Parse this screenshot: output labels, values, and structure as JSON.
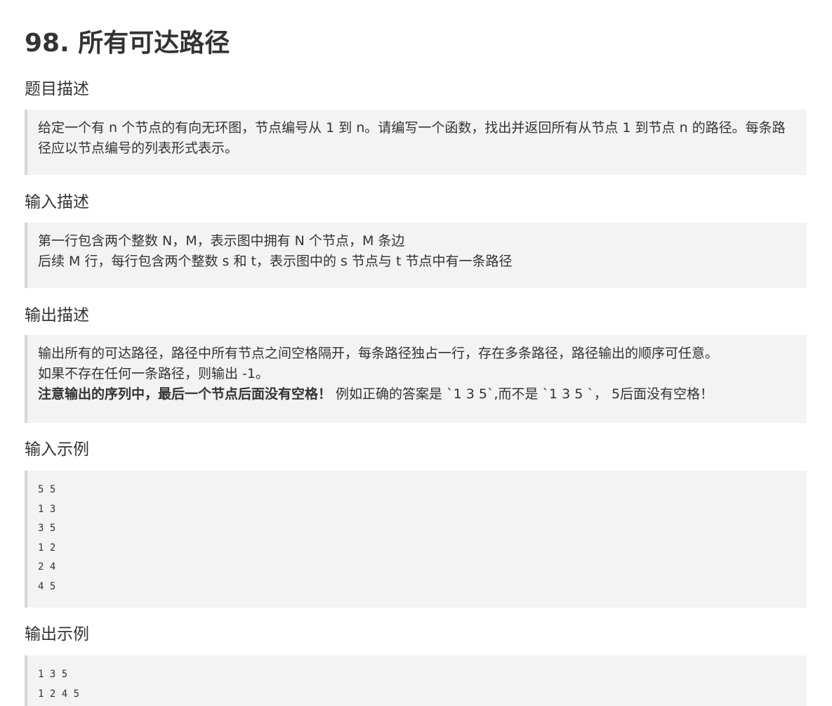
{
  "title": "98. 所有可达路径",
  "sections": {
    "description": {
      "heading": "题目描述",
      "text": "给定一个有 n 个节点的有向无环图，节点编号从 1 到 n。请编写一个函数，找出并返回所有从节点 1 到节点 n 的路径。每条路径应以节点编号的列表形式表示。"
    },
    "input": {
      "heading": "输入描述",
      "lines": [
        "第一行包含两个整数 N，M，表示图中拥有 N 个节点，M 条边",
        "后续 M 行，每行包含两个整数 s 和 t，表示图中的 s 节点与 t 节点中有一条路径"
      ]
    },
    "output": {
      "heading": "输出描述",
      "line1": "输出所有的可达路径，路径中所有节点之间空格隔开，每条路径独占一行，存在多条路径，路径输出的顺序可任意。",
      "line2": "如果不存在任何一条路径，则输出 -1。",
      "note_bold": "注意输出的序列中，最后一个节点后面没有空格！",
      "note_rest": " 例如正确的答案是 `1 3 5`,而不是 `1 3 5 `， 5后面没有空格！"
    },
    "input_example": {
      "heading": "输入示例",
      "lines": [
        "5 5",
        "1 3",
        "3 5",
        "1 2",
        "2 4",
        "4 5"
      ]
    },
    "output_example": {
      "heading": "输出示例",
      "lines": [
        "1 3 5",
        "1 2 4 5"
      ]
    }
  }
}
